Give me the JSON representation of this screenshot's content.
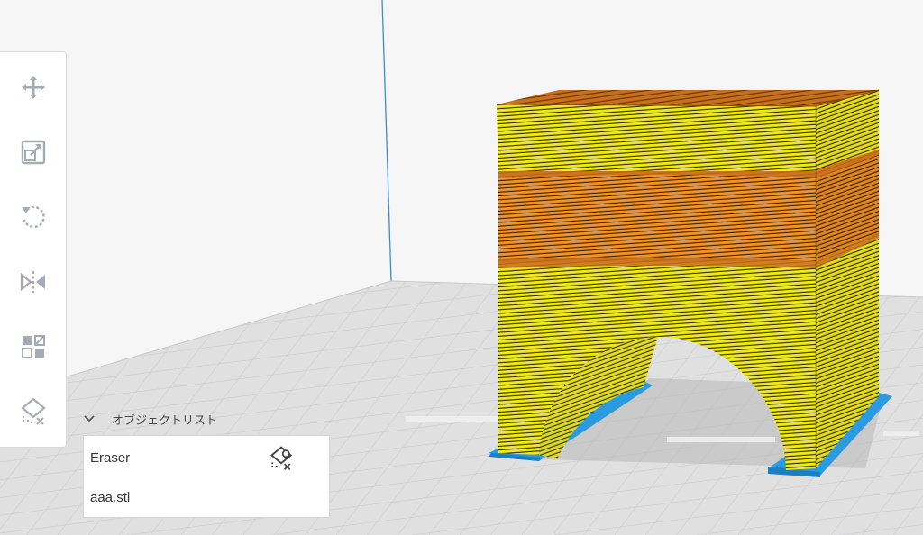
{
  "toolbar": {
    "tools": [
      {
        "name": "move",
        "icon": "move-icon"
      },
      {
        "name": "scale",
        "icon": "scale-icon"
      },
      {
        "name": "rotate",
        "icon": "rotate-icon"
      },
      {
        "name": "mirror",
        "icon": "mirror-icon"
      },
      {
        "name": "per-model-settings",
        "icon": "per-model-settings-icon"
      },
      {
        "name": "support-blocker",
        "icon": "support-blocker-icon"
      }
    ]
  },
  "object_list": {
    "title": "オブジェクトリスト",
    "items": [
      {
        "label": "Eraser",
        "icon": "support-blocker-icon"
      },
      {
        "label": "aaa.stl"
      }
    ]
  },
  "colors": {
    "background": "#f5f5f6",
    "build_plate": "#dcdcdc",
    "model_yellow": "#f2ea1c",
    "model_orange": "#f29a2c",
    "brim_blue": "#2a9be0",
    "icon_gray": "#a6aab2"
  }
}
